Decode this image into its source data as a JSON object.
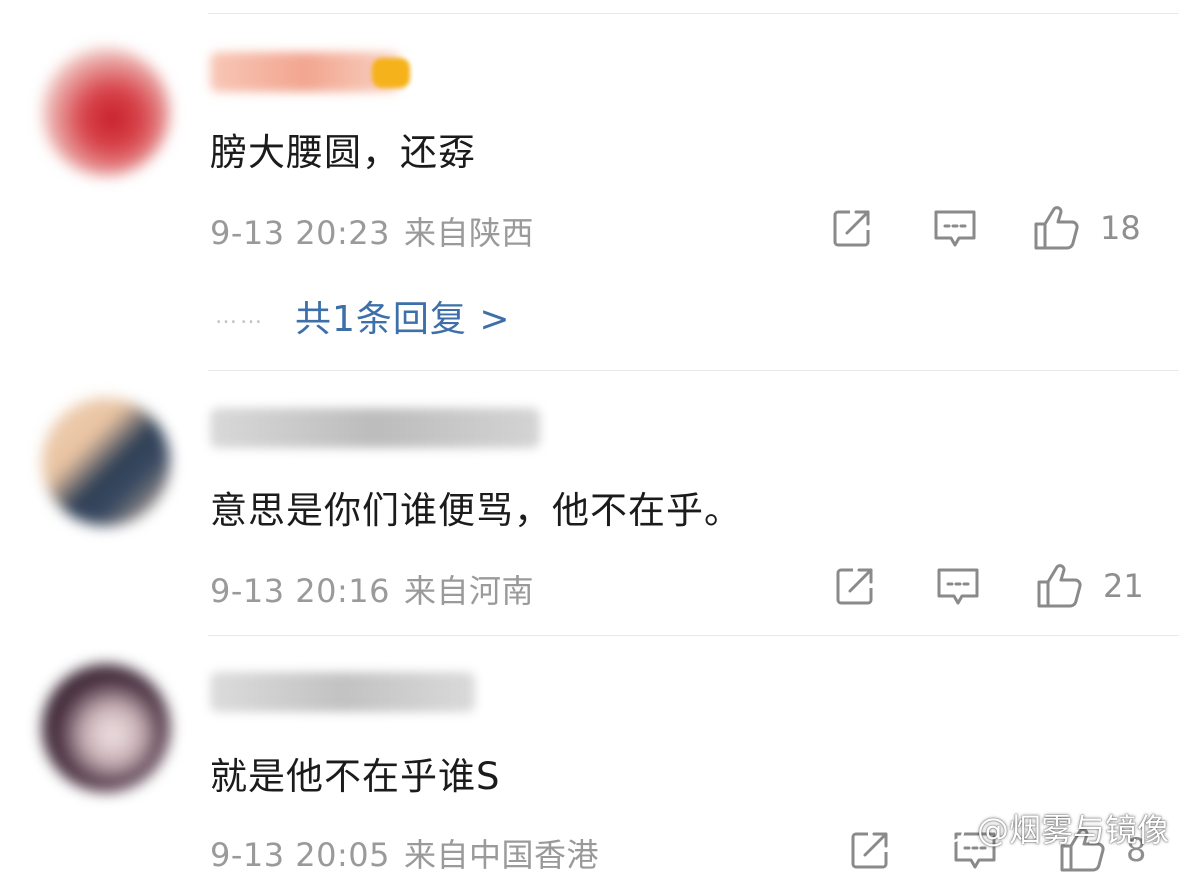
{
  "comments": [
    {
      "text": "膀大腰圆，还孬",
      "date": "9-13 20:23",
      "location": "来自陕西",
      "likes": "18",
      "reply_summary": "共1条回复 >",
      "avatar_colors": [
        "#f0c9c4",
        "#c8202a"
      ]
    },
    {
      "text": "意思是你们谁便骂，他不在乎。",
      "date": "9-13 20:16",
      "location": "来自河南",
      "likes": "21",
      "avatar_colors": [
        "#e9c6a6",
        "#2d3e55"
      ]
    },
    {
      "text": "就是他不在乎谁S",
      "date": "9-13 20:05",
      "location": "来自中国香港",
      "likes": "8",
      "avatar_colors": [
        "#2a1f2a",
        "#e6d6d6"
      ]
    }
  ],
  "reply_dots": "……",
  "watermark": {
    "text": "@烟雾与镜像",
    "icon": "weibo-logo-icon"
  },
  "icons": {
    "forward": "share-icon",
    "comment": "comment-icon",
    "like": "thumbs-up-icon"
  }
}
